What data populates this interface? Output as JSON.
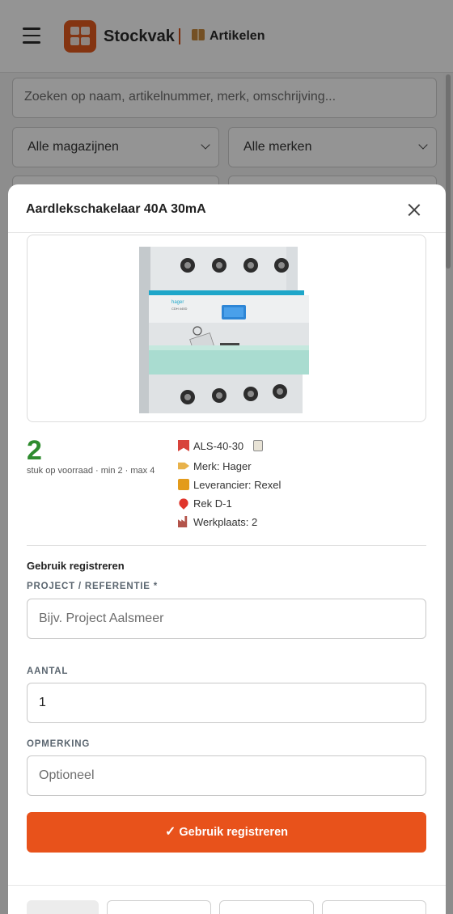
{
  "header": {
    "brand": "Stockvak",
    "section_label": "Artikelen",
    "section_icon": "package-icon"
  },
  "filters": {
    "search_placeholder": "Zoeken op naam, artikelnummer, merk, omschrijving...",
    "warehouse_select": "Alle magazijnen",
    "brand_select": "Alle merken"
  },
  "modal": {
    "title": "Aardlekschakelaar 40A 30mA",
    "stock": {
      "count": "2",
      "subtitle": "stuk op voorraad · min 2 · max 4"
    },
    "meta": {
      "sku": "ALS-40-30",
      "brand": "Merk: Hager",
      "supplier": "Leverancier: Rexel",
      "location": "Rek D-1",
      "workshop": "Werkplaats: 2"
    },
    "usage": {
      "title": "Gebruik registreren",
      "project_label": "PROJECT / REFERENTIE *",
      "project_placeholder": "Bijv. Project Aalsmeer",
      "qty_label": "AANTAL",
      "qty_value": "1",
      "note_label": "OPMERKING",
      "note_placeholder": "Optioneel",
      "submit_label": "Gebruik registreren"
    },
    "product_image": {
      "brand_text": "hager",
      "model_text": "CDH 440D"
    }
  },
  "colors": {
    "accent": "#e8521b",
    "stock_ok": "#2e8b2e"
  }
}
